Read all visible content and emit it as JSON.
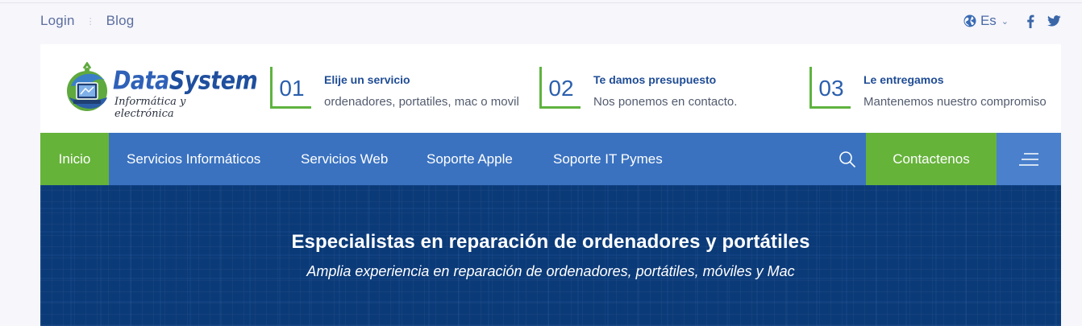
{
  "topbar": {
    "login": "Login",
    "blog": "Blog",
    "language": "Es"
  },
  "logo": {
    "name_part1": "Data",
    "name_part2": "System",
    "tagline": "Informática y electrónica"
  },
  "steps": [
    {
      "number": "01",
      "title": "Elije un servicio",
      "text": "ordenadores, portatiles, mac o movil"
    },
    {
      "number": "02",
      "title": "Te damos presupuesto",
      "text": "Nos ponemos en contacto."
    },
    {
      "number": "03",
      "title": "Le entregamos",
      "text": "Mantenemos nuestro compromiso"
    }
  ],
  "nav": {
    "items": [
      "Inicio",
      "Servicios Informáticos",
      "Servicios Web",
      "Soporte Apple",
      "Soporte IT Pymes"
    ],
    "contact": "Contactenos"
  },
  "hero": {
    "title": "Especialistas en reparación de ordenadores y portátiles",
    "subtitle": "Amplia experiencia en reparación de ordenadores, portátiles, móviles y Mac"
  },
  "colors": {
    "nav_blue": "#3a72c0",
    "accent_green": "#66b33a",
    "hero_navy": "#0b3a78"
  }
}
